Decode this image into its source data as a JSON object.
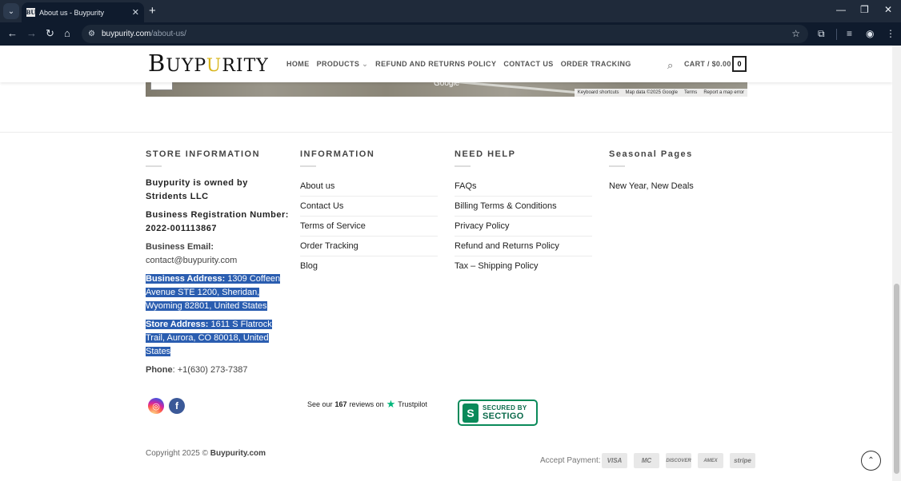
{
  "browser": {
    "tab_title": "About us - Buypurity",
    "favicon_text": "BU",
    "url_host": "buypurity.com",
    "url_path": "/about-us/"
  },
  "header": {
    "logo_parts": [
      "B",
      "UYP",
      "U",
      "RITY"
    ],
    "nav": [
      "HOME",
      "PRODUCTS",
      "REFUND AND RETURNS POLICY",
      "CONTACT US",
      "ORDER TRACKING"
    ],
    "cart_label": "CART / $0.00",
    "cart_count": "0"
  },
  "map": {
    "google_text": "Google",
    "footer": [
      "Keyboard shortcuts",
      "Map data ©2025 Google",
      "Terms",
      "Report a map error"
    ]
  },
  "store": {
    "title": "STORE INFORMATION",
    "owned": "Buypurity is owned by Stridents LLC",
    "registration": "Business Registration Number: 2022-001113867",
    "email_label": "Business Email:",
    "email": "contact@buypurity.com",
    "address_label": "Business Address:",
    "address": "1309 Coffeen Avenue STE 1200, Sheridan, Wyoming 82801, United States",
    "store_label": "Store Address:",
    "store_address": "1611 S Flatrock Trail, Aurora, CO 80018, United States",
    "phone_label": "Phone",
    "phone": ": +1(630) 273-7387"
  },
  "information": {
    "title": "INFORMATION",
    "links": [
      "About us",
      "Contact Us",
      "Terms of Service",
      "Order Tracking",
      "Blog"
    ]
  },
  "help": {
    "title": "NEED HELP",
    "links": [
      "FAQs",
      "Billing Terms & Conditions",
      "Privacy Policy",
      "Refund and Returns Policy",
      "Tax – Shipping Policy"
    ]
  },
  "seasonal": {
    "title": "Seasonal Pages",
    "links": [
      "New Year, New Deals"
    ]
  },
  "trustpilot": {
    "prefix": "See our",
    "count": "167",
    "suffix": "reviews on",
    "brand": "Trustpilot"
  },
  "sectigo": {
    "line1": "SECURED BY",
    "line2": "SECTIGO"
  },
  "footer": {
    "copyright": "Copyright 2025 ©",
    "brand": "Buypurity.com",
    "pay_label": "Accept Payment:",
    "pay_methods": [
      "VISA",
      "MC",
      "DISCOVER",
      "AMEX",
      "stripe"
    ]
  }
}
